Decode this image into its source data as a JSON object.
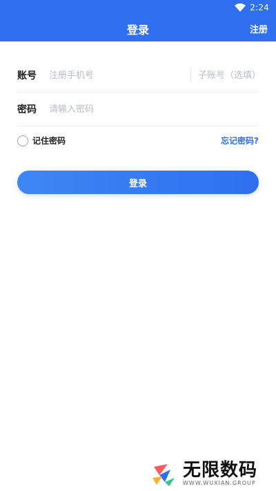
{
  "status_bar": {
    "time": "2:24"
  },
  "header": {
    "title": "登录",
    "register_label": "注册"
  },
  "form": {
    "account": {
      "label": "账号",
      "placeholder": "注册手机号",
      "sub_placeholder": "子账号（选填）"
    },
    "password": {
      "label": "密码",
      "placeholder": "请输入密码"
    }
  },
  "options": {
    "remember_label": "记住密码",
    "forgot_label": "忘记密码?"
  },
  "login_button": {
    "label": "登录"
  },
  "watermark": {
    "title": "无限数码",
    "subtitle": "WWW.WUXIAN.GROUP"
  },
  "colors": {
    "primary": "#2f6ff0",
    "button_gradient_start": "#3f86f4",
    "background": "#ffffff"
  },
  "icons": [
    "wifi-icon",
    "radio-unchecked-icon",
    "logo-icon"
  ]
}
